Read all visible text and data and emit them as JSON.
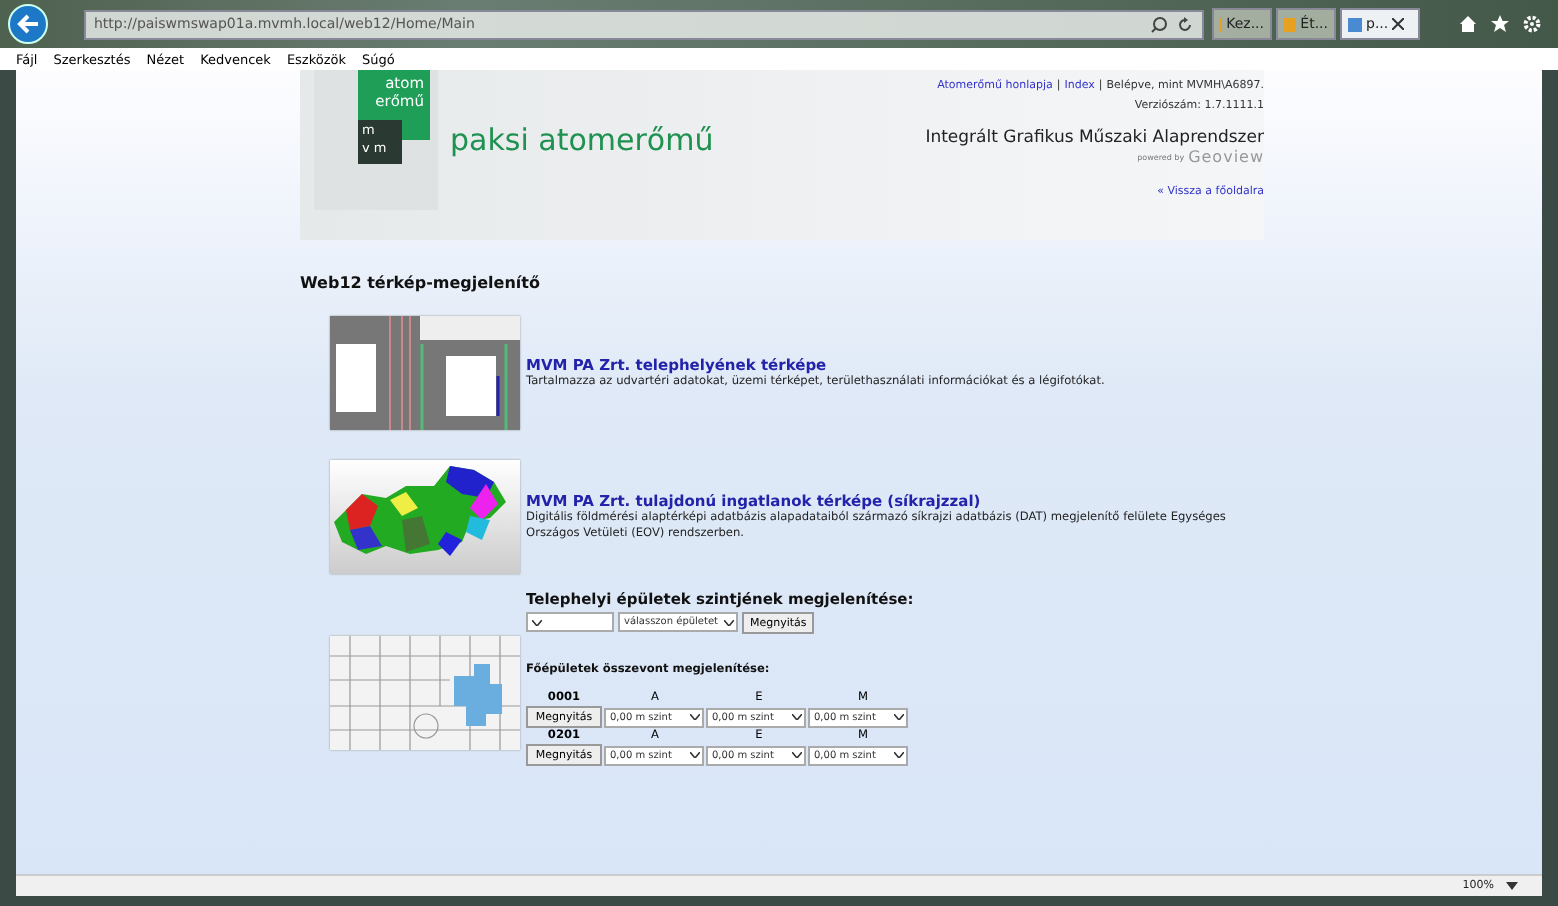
{
  "browser": {
    "address": "http://paiswmswap01a.mvmh.local/web12/Home/Main",
    "tabs": [
      {
        "label": "Kez...",
        "selected": false
      },
      {
        "label": "Ét...",
        "selected": false
      },
      {
        "label": "p...",
        "selected": true
      }
    ],
    "menu": [
      "Fájl",
      "Szerkesztés",
      "Nézet",
      "Kedvencek",
      "Eszközök",
      "Súgó"
    ],
    "zoom": "100%"
  },
  "header": {
    "logo_top": "atom",
    "logo_mid": "erőmű",
    "logo_m": "m",
    "logo_vm": "v m",
    "brand": "paksi atomerőmű",
    "links": [
      "Atomerőmű honlapja",
      "Index"
    ],
    "separator": "|",
    "login": "Belépve, mint MVMH\\A6897.",
    "version": "Verziószám: 1.7.1111.1",
    "system": "Integrált Grafikus Műszaki Alaprendszer",
    "powered": "powered by",
    "vendor": "Geoview",
    "back": "« Vissza a főoldalra"
  },
  "page_title": "Web12 térkép-megjelenítő",
  "maps": [
    {
      "kind": "site",
      "title": "MVM PA Zrt. telephelyének térképe",
      "description": "Tartalmazza az udvartéri adatokat, üzemi térképet, területhasználati információkat és a légifotókat."
    },
    {
      "kind": "country",
      "title": "MVM PA Zrt. tulajdonú ingatlanok térképe (síkrajzzal)",
      "description": "Digitális földmérési alaptérképi adatbázis alapadataiból származó síkrajzi adatbázis (DAT) megjelenítő felülete Egységes Országos Vetületi (EOV) rendszerben."
    }
  ],
  "buildings": {
    "title": "Telephelyi épületek szintjének megjelenítése:",
    "building_select": "válasszon épületet",
    "open": "Megnyitás",
    "merged_title": "Főépületek összevont megjelenítése:",
    "rows": [
      {
        "code": "0001",
        "button": "Megnyitás",
        "levels": [
          {
            "column": "A",
            "value": "0,00 m szint"
          },
          {
            "column": "E",
            "value": "0,00 m szint"
          },
          {
            "column": "M",
            "value": "0,00 m szint"
          }
        ]
      },
      {
        "code": "0201",
        "button": "Megnyitás",
        "levels": [
          {
            "column": "A",
            "value": "0,00 m szint"
          },
          {
            "column": "E",
            "value": "0,00 m szint"
          },
          {
            "column": "M",
            "value": "0,00 m szint"
          }
        ]
      }
    ]
  }
}
